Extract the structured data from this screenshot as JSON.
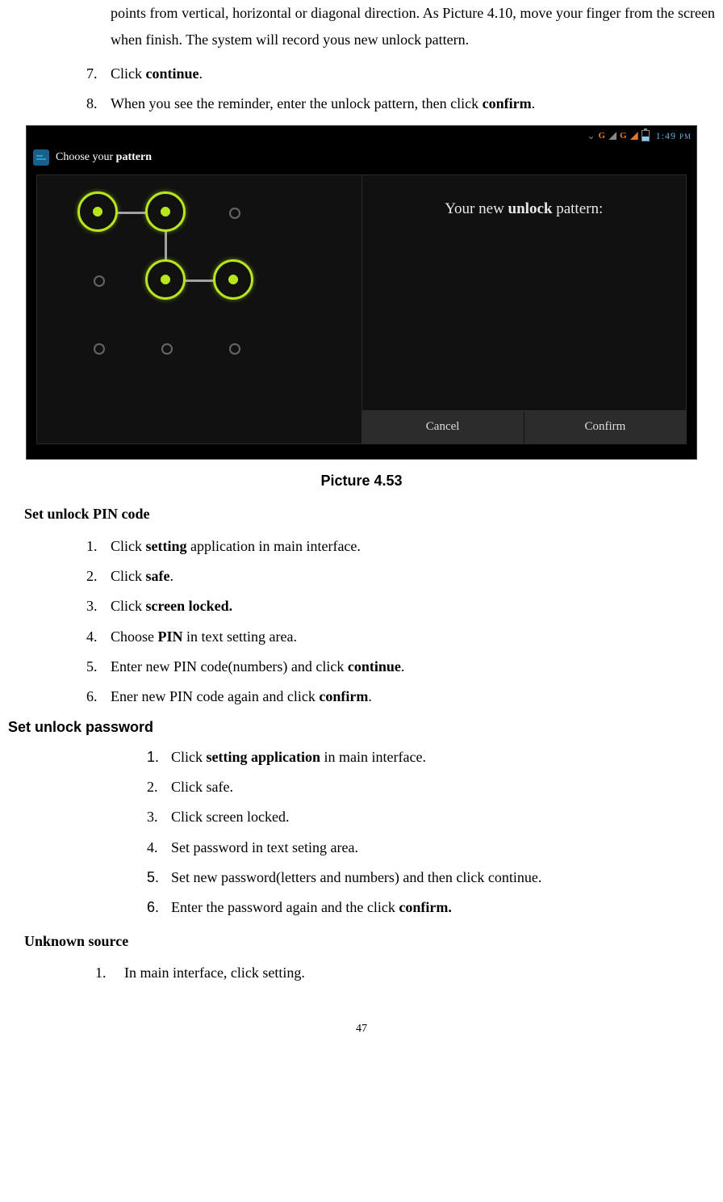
{
  "topParagraph": "points from vertical, horizontal or diagonal direction. As Picture 4.10, move your finger from the screen when finish. The system will record yous new unlock pattern.",
  "list1": {
    "items": {
      "7": {
        "num": "7.",
        "pre": "Click ",
        "bold": "continue",
        "post": "."
      },
      "8": {
        "num": "8.",
        "pre": "When you see the reminder, enter the unlock pattern, then click ",
        "bold": "confirm",
        "post": "."
      }
    }
  },
  "figure": {
    "status": {
      "g": "G",
      "time": "1:49",
      "ampm": "PM"
    },
    "title": {
      "pre": "Choose your ",
      "bold": "pattern"
    },
    "rightText": {
      "pre": "Your new ",
      "bold": "unlock",
      "post": " pattern:"
    },
    "cancel": "Cancel",
    "confirm": "Confirm"
  },
  "caption": "Picture 4.53",
  "pinHeading": "Set unlock PIN code",
  "pinList": {
    "1": {
      "num": "1.",
      "pre": "Click ",
      "bold": "setting",
      "post": " application in main interface."
    },
    "2": {
      "num": "2.",
      "pre": "Click ",
      "bold": "safe",
      "post": "."
    },
    "3": {
      "num": "3.",
      "pre": "Click ",
      "bold": "screen locked.",
      "post": ""
    },
    "4": {
      "num": "4.",
      "pre": "Choose ",
      "bold": "PIN",
      "post": " in text setting area."
    },
    "5": {
      "num": "5.",
      "pre": "Enter new PIN code(numbers) and click ",
      "bold": "continue",
      "post": "."
    },
    "6": {
      "num": "6.",
      "pre": "Ener new PIN code again and click ",
      "bold": "confirm",
      "post": "."
    }
  },
  "pwdHeading": "Set unlock password",
  "pwdList": {
    "1": {
      "num": "1.",
      "pre": "Click ",
      "bold": "setting application",
      "post": " in main interface."
    },
    "2": {
      "num": "2.",
      "text": "Click safe."
    },
    "3": {
      "num": "3.",
      "text": "Click screen locked."
    },
    "4": {
      "num": "4.",
      "text": "Set password in text seting area."
    },
    "5": {
      "num": "5.",
      "text": "Set new password(letters and numbers) and then click continue."
    },
    "6": {
      "num": "6.",
      "pre": "Enter the password again and the click ",
      "bold": "confirm.",
      "post": ""
    }
  },
  "unknownHeading": "Unknown source",
  "unknownList": {
    "1": {
      "num": "1.",
      "text": "In main interface, click setting."
    }
  },
  "pageNumber": "47"
}
